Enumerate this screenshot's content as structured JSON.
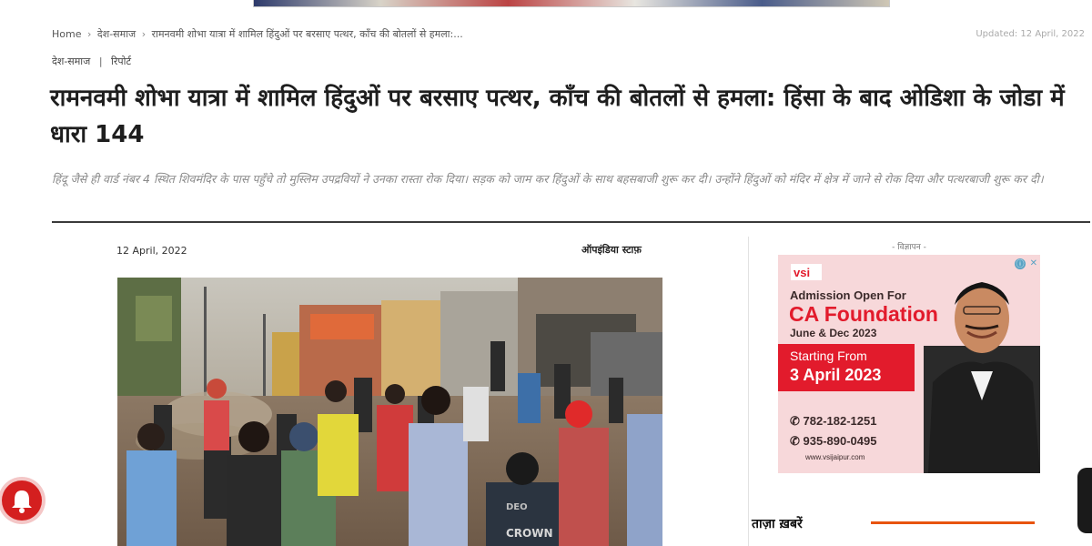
{
  "breadcrumb": {
    "home": "Home",
    "sep": "›",
    "category": "देश-समाज",
    "current": "रामनवमी शोभा यात्रा में शामिल हिंदुओं पर बरसाए पत्थर, काँच की बोतलों से हमला:..."
  },
  "updated": "Updated: 12 April, 2022",
  "categories": [
    "देश-समाज",
    "रिपोर्ट"
  ],
  "category_sep": "|",
  "headline": "रामनवमी शोभा यात्रा में शामिल हिंदुओं पर बरसाए पत्थर, काँच की बोतलों से हमला: हिंसा के बाद ओडिशा के जोडा में धारा 144",
  "summary": "हिंदू जैसे ही वार्ड नंबर 4 स्थित शिवमंदिर के पास पहुँचे तो मुस्लिम उपद्रवियों ने उनका रास्ता रोक दिया। सड़क को जाम कर हिंदुओं के साथ बहसबाजी शुरू कर दी। उन्होंने हिंदुओं को मंदिर में क्षेत्र में जाने से रोक दिया और पत्थरबाजी शुरू कर दी।",
  "meta": {
    "date": "12 April, 2022",
    "author": "ऑपइंडिया स्टाफ़"
  },
  "photo_text": {
    "shirt": "CROWN",
    "shirt2": "DEO"
  },
  "ad": {
    "label": "- विज्ञापन -",
    "logo": "vsi",
    "line1": "Admission Open For",
    "line2": "CA Foundation",
    "line3": "June & Dec 2023",
    "line4": "Starting From",
    "line5": "3 April 2023",
    "phone1": "782-182-1251",
    "phone2": "935-890-0495",
    "website": "www.vsijaipur.com",
    "info_icon": "ⓘ",
    "close_icon": "✕",
    "colors": {
      "bg": "#f7d8da",
      "red": "#e21b2c",
      "dark": "#3b2a2a"
    }
  },
  "sidebar": {
    "latest_title": "ताज़ा ख़बरें"
  },
  "colors": {
    "accent": "#e8540f",
    "bell": "#d41f1f"
  }
}
